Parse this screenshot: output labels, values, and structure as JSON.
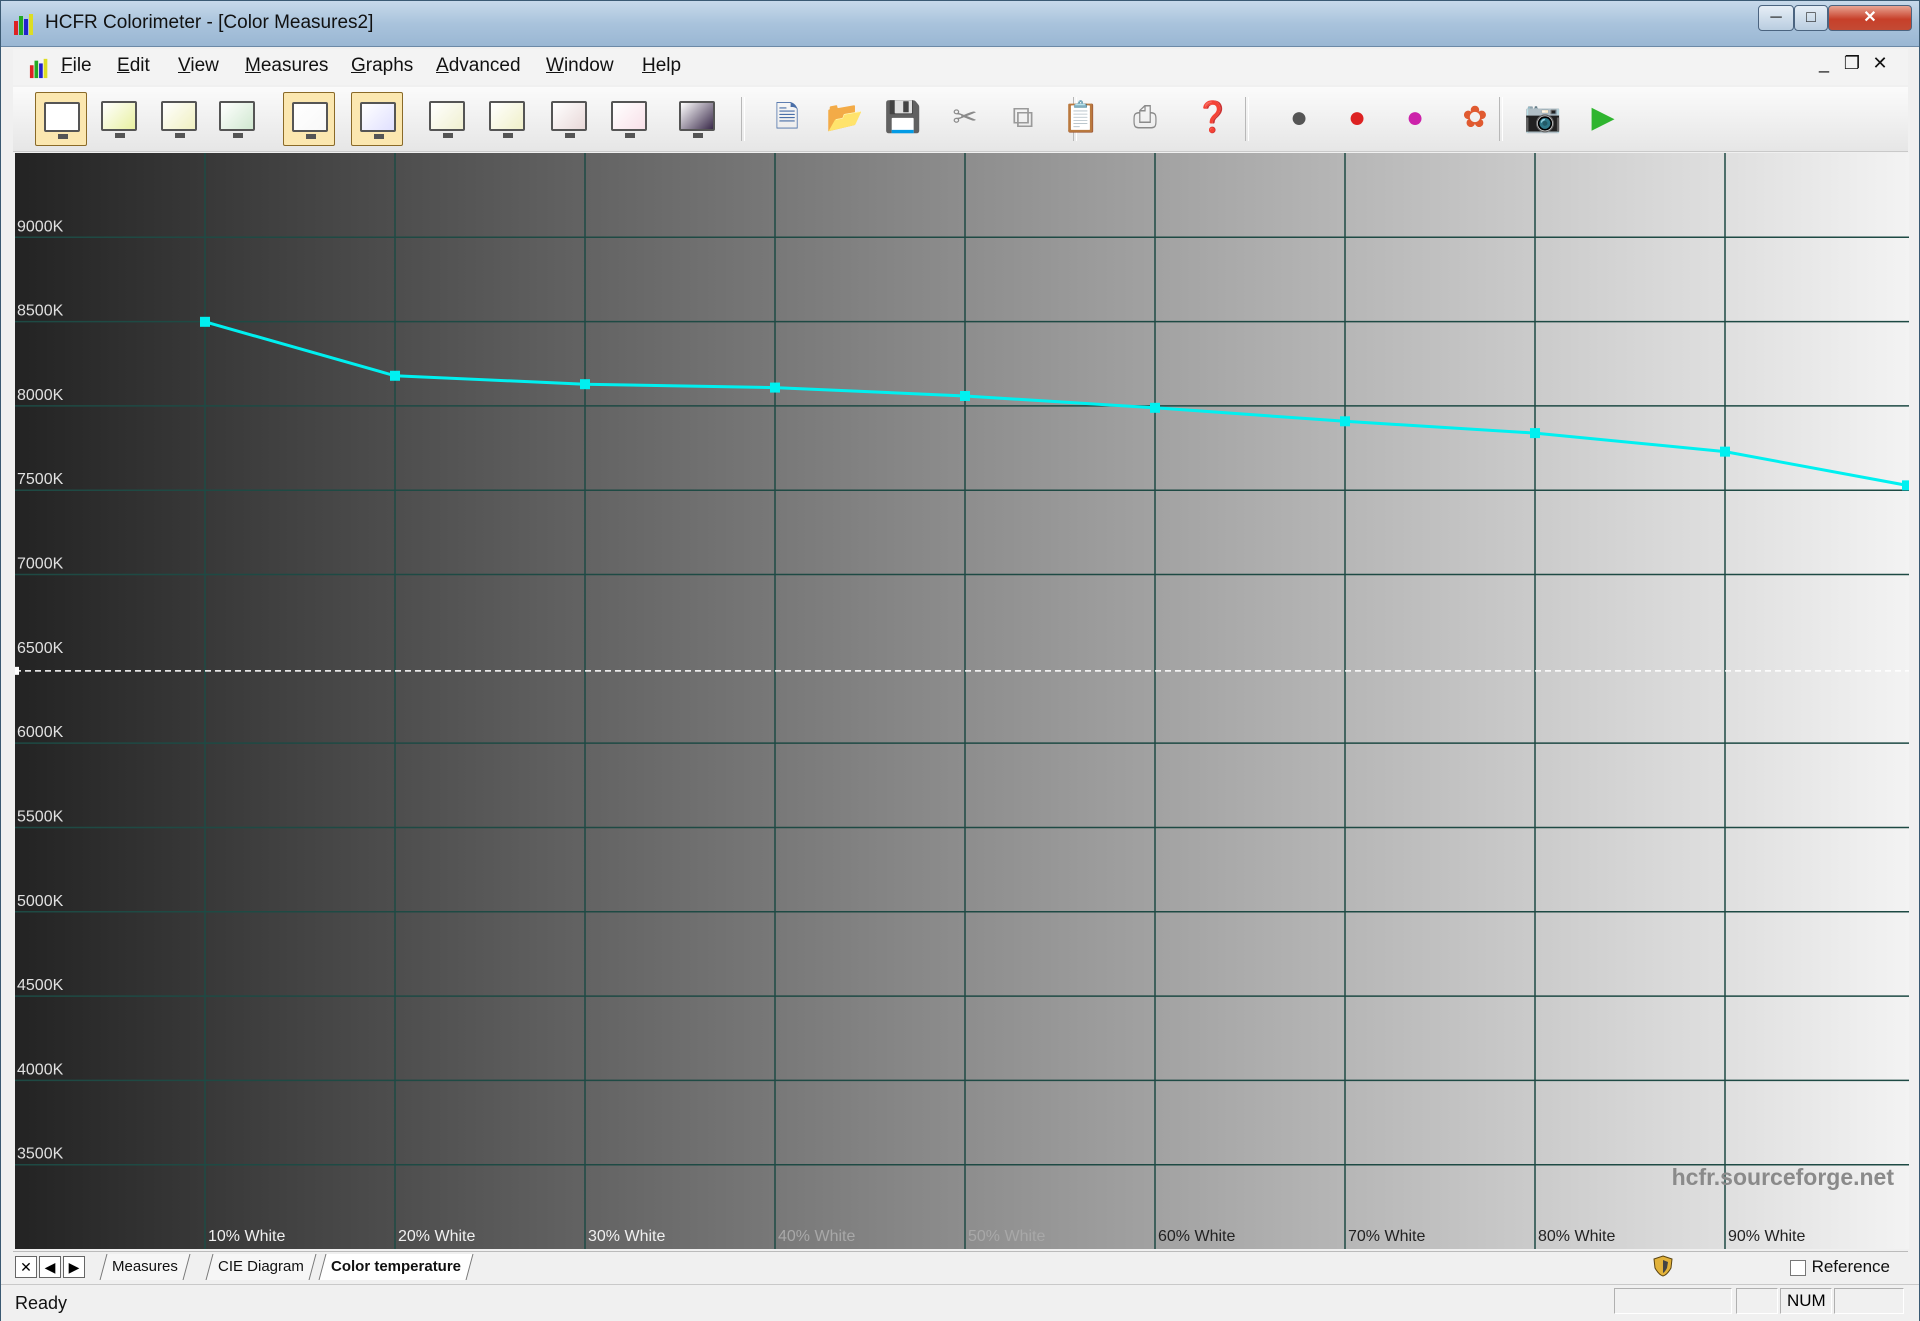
{
  "window": {
    "title": "HCFR Colorimeter - [Color Measures2]"
  },
  "menu": {
    "items": [
      "File",
      "Edit",
      "View",
      "Measures",
      "Graphs",
      "Advanced",
      "Window",
      "Help"
    ]
  },
  "toolbar": {
    "icons": [
      "monitor-measures-icon",
      "monitor-gamma-icon",
      "monitor-luminance-icon",
      "monitor-rgb-levels-icon",
      "monitor-color-temp-icon",
      "monitor-cie-icon",
      "monitor-saturation-icon",
      "monitor-saturation-shift-icon",
      "monitor-near-black-icon",
      "monitor-near-white-icon",
      "monitor-dark-icon",
      "new-document-icon",
      "open-folder-icon",
      "save-disk-icon",
      "cut-icon",
      "copy-icon",
      "paste-icon",
      "print-icon",
      "help-icon",
      "gray-measure-icon",
      "primary-colors-icon",
      "secondary-colors-icon",
      "all-colors-icon",
      "camera-icon",
      "play-icon"
    ],
    "active": [
      0,
      4,
      5
    ]
  },
  "chart_data": {
    "type": "line",
    "title": "",
    "ylabel": "",
    "xlabel": "",
    "ylim": [
      3000,
      9500
    ],
    "y_ticks": [
      "3500K",
      "4000K",
      "4500K",
      "5000K",
      "5500K",
      "6000K",
      "6500K",
      "7000K",
      "7500K",
      "8000K",
      "8500K",
      "9000K"
    ],
    "y_tick_values": [
      3500,
      4000,
      4500,
      5000,
      5500,
      6000,
      6500,
      7000,
      7500,
      8000,
      8500,
      9000
    ],
    "categories": [
      "10% White",
      "20% White",
      "30% White",
      "40% White",
      "50% White",
      "60% White",
      "70% White",
      "80% White",
      "90% White"
    ],
    "series": [
      {
        "values": [
          8570,
          8250,
          8200,
          8180,
          8130,
          8060,
          7980,
          7910,
          7800,
          7600
        ],
        "color": "#00f0f0"
      }
    ],
    "reference_line": 6500,
    "grid": true,
    "watermark": "hcfr.sourceforge.net",
    "colors": {
      "line": "#00f0f0",
      "grid": "#1e4a44",
      "reference": "#ffffff"
    }
  },
  "tabs": {
    "items": [
      "Measures",
      "CIE Diagram",
      "Color temperature"
    ],
    "selected": 2
  },
  "reference": {
    "label": "Reference",
    "checked": false
  },
  "status": {
    "text": "Ready",
    "num": "NUM"
  }
}
